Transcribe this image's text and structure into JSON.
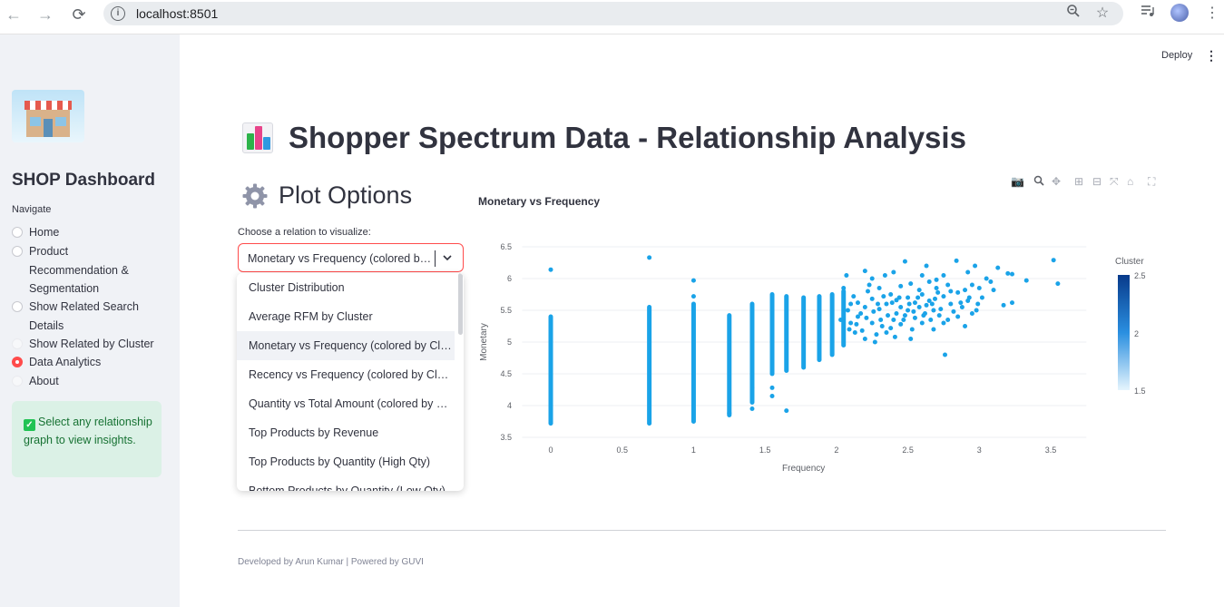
{
  "browser": {
    "url": "localhost:8501"
  },
  "sidebar": {
    "title": "SHOP Dashboard",
    "nav_label": "Navigate",
    "items": [
      {
        "label": "Home"
      },
      {
        "label": "Product Recommendation & Segmentation"
      },
      {
        "label": "Show Related Search Details"
      },
      {
        "label": "Show Related by Cluster"
      },
      {
        "label": "Data Analytics"
      },
      {
        "label": "About"
      }
    ],
    "selected": "Data Analytics",
    "info": "Select any relationship graph to view insights."
  },
  "header": {
    "deploy_label": "Deploy"
  },
  "main": {
    "title": "Shopper Spectrum Data - Relationship Analysis",
    "plot_options_title": "Plot Options",
    "select_label": "Choose a relation to visualize:",
    "select_value": "Monetary vs Frequency (colored by Cluster)",
    "options": [
      "Cluster Distribution",
      "Average RFM by Cluster",
      "Monetary vs Frequency (colored by Cluster)",
      "Recency vs Frequency (colored by Cluster)",
      "Quantity vs Total Amount (colored by Cluster)",
      "Top Products by Revenue",
      "Top Products by Quantity (High Qty)",
      "Bottom Products by Quantity (Low Qty)"
    ],
    "plot_title": "Monetary vs Frequency"
  },
  "footer": {
    "text": "Developed by Arun Kumar | Powered by GUVI"
  },
  "colors": {
    "accent": "#ff4b4b",
    "point": "#1aa3e8",
    "info_bg": "#dbf1e6"
  },
  "chart_data": {
    "type": "scatter",
    "xlabel": "Frequency",
    "ylabel": "Monetary",
    "xlim": [
      -0.2,
      3.75
    ],
    "ylim": [
      3.5,
      6.5
    ],
    "x_ticks": [
      "0",
      "0.5",
      "1",
      "1.5",
      "2",
      "2.5",
      "3",
      "3.5"
    ],
    "y_ticks": [
      "3.5",
      "4",
      "4.5",
      "5",
      "5.5",
      "6",
      "6.5"
    ],
    "colorbar": {
      "title": "Cluster",
      "ticks": [
        "2.5",
        "2",
        "1.5"
      ]
    },
    "columns": [
      {
        "x": 0,
        "ymin": 3.72,
        "ymax": 5.4
      },
      {
        "x": 0.69,
        "ymin": 3.72,
        "ymax": 5.55
      },
      {
        "x": 1.0,
        "ymin": 3.75,
        "ymax": 5.6
      },
      {
        "x": 1.25,
        "ymin": 3.85,
        "ymax": 5.42
      },
      {
        "x": 1.41,
        "ymin": 4.05,
        "ymax": 5.6
      },
      {
        "x": 1.55,
        "ymin": 4.5,
        "ymax": 5.75
      },
      {
        "x": 1.65,
        "ymin": 4.55,
        "ymax": 5.72
      },
      {
        "x": 1.77,
        "ymin": 4.6,
        "ymax": 5.7
      },
      {
        "x": 1.88,
        "ymin": 4.72,
        "ymax": 5.72
      },
      {
        "x": 1.97,
        "ymin": 4.8,
        "ymax": 5.75
      },
      {
        "x": 2.05,
        "ymin": 4.95,
        "ymax": 5.8
      }
    ],
    "points": [
      [
        0,
        6.14
      ],
      [
        0.69,
        6.33
      ],
      [
        1.0,
        5.97
      ],
      [
        1.0,
        5.72
      ],
      [
        1.41,
        4.28
      ],
      [
        1.41,
        3.95
      ],
      [
        1.55,
        4.15
      ],
      [
        1.55,
        4.28
      ],
      [
        1.65,
        3.92
      ],
      [
        1.25,
        3.88
      ],
      [
        2.07,
        6.05
      ],
      [
        2.2,
        6.12
      ],
      [
        2.25,
        6.0
      ],
      [
        2.34,
        6.05
      ],
      [
        2.4,
        6.1
      ],
      [
        2.48,
        6.27
      ],
      [
        2.6,
        6.05
      ],
      [
        2.63,
        6.2
      ],
      [
        2.75,
        6.05
      ],
      [
        2.84,
        6.28
      ],
      [
        2.92,
        6.1
      ],
      [
        2.97,
        6.2
      ],
      [
        3.05,
        6.0
      ],
      [
        3.13,
        6.17
      ],
      [
        3.2,
        6.08
      ],
      [
        3.23,
        6.07
      ],
      [
        3.33,
        5.97
      ],
      [
        3.52,
        6.29
      ],
      [
        3.55,
        5.92
      ],
      [
        3.17,
        5.58
      ],
      [
        3.23,
        5.62
      ],
      [
        2.98,
        5.5
      ],
      [
        2.76,
        4.8
      ],
      [
        2.52,
        5.05
      ],
      [
        2.41,
        5.08
      ],
      [
        2.1,
        5.3
      ],
      [
        2.15,
        5.4
      ],
      [
        2.2,
        5.55
      ],
      [
        2.3,
        5.52
      ],
      [
        2.35,
        5.6
      ],
      [
        2.45,
        5.55
      ],
      [
        2.5,
        5.7
      ],
      [
        2.55,
        5.62
      ],
      [
        2.6,
        5.75
      ],
      [
        2.65,
        5.65
      ],
      [
        2.7,
        5.85
      ],
      [
        2.75,
        5.72
      ],
      [
        2.8,
        5.6
      ],
      [
        2.85,
        5.78
      ],
      [
        2.9,
        5.82
      ],
      [
        2.95,
        5.9
      ],
      [
        3.0,
        5.85
      ],
      [
        2.25,
        5.3
      ],
      [
        2.32,
        5.25
      ],
      [
        2.4,
        5.35
      ],
      [
        2.48,
        5.42
      ],
      [
        2.55,
        5.38
      ],
      [
        2.62,
        5.45
      ],
      [
        2.68,
        5.5
      ],
      [
        2.72,
        5.42
      ],
      [
        2.82,
        5.48
      ],
      [
        2.88,
        5.55
      ],
      [
        2.18,
        5.18
      ],
      [
        2.28,
        5.12
      ],
      [
        2.38,
        5.22
      ],
      [
        2.45,
        5.28
      ],
      [
        2.12,
        5.72
      ],
      [
        2.22,
        5.8
      ],
      [
        2.3,
        5.85
      ],
      [
        2.38,
        5.75
      ],
      [
        2.45,
        5.88
      ],
      [
        2.52,
        5.92
      ],
      [
        2.58,
        5.82
      ],
      [
        2.65,
        5.95
      ],
      [
        2.7,
        5.98
      ],
      [
        2.78,
        5.9
      ],
      [
        2.15,
        5.62
      ],
      [
        2.25,
        5.68
      ],
      [
        2.33,
        5.72
      ],
      [
        2.42,
        5.66
      ],
      [
        2.5,
        5.5
      ],
      [
        2.58,
        5.55
      ],
      [
        2.66,
        5.35
      ],
      [
        2.75,
        5.3
      ],
      [
        2.85,
        5.4
      ],
      [
        2.92,
        5.65
      ],
      [
        3.02,
        5.7
      ],
      [
        3.08,
        5.95
      ],
      [
        3.1,
        5.82
      ],
      [
        2.08,
        5.5
      ],
      [
        2.13,
        5.15
      ],
      [
        2.2,
        5.05
      ],
      [
        2.27,
        5.0
      ],
      [
        2.35,
        5.15
      ],
      [
        2.42,
        5.45
      ],
      [
        2.53,
        5.2
      ],
      [
        2.6,
        5.3
      ],
      [
        2.68,
        5.2
      ],
      [
        2.78,
        5.35
      ],
      [
        2.9,
        5.25
      ],
      [
        2.95,
        5.45
      ],
      [
        2.05,
        5.85
      ],
      [
        2.1,
        5.6
      ],
      [
        2.17,
        5.45
      ],
      [
        2.23,
        5.9
      ],
      [
        2.29,
        5.6
      ],
      [
        2.36,
        5.42
      ],
      [
        2.44,
        5.7
      ],
      [
        2.51,
        5.6
      ],
      [
        2.57,
        5.7
      ],
      [
        2.63,
        5.58
      ],
      [
        2.69,
        5.68
      ],
      [
        2.73,
        5.52
      ],
      [
        2.8,
        5.8
      ],
      [
        2.87,
        5.62
      ],
      [
        2.93,
        5.7
      ],
      [
        2.99,
        5.6
      ],
      [
        2.03,
        5.35
      ],
      [
        2.09,
        5.2
      ],
      [
        2.14,
        5.28
      ],
      [
        2.21,
        5.38
      ],
      [
        2.26,
        5.48
      ],
      [
        2.31,
        5.35
      ],
      [
        2.39,
        5.62
      ],
      [
        2.47,
        5.35
      ],
      [
        2.54,
        5.48
      ],
      [
        2.61,
        5.42
      ],
      [
        2.67,
        5.6
      ],
      [
        2.71,
        5.78
      ]
    ]
  }
}
